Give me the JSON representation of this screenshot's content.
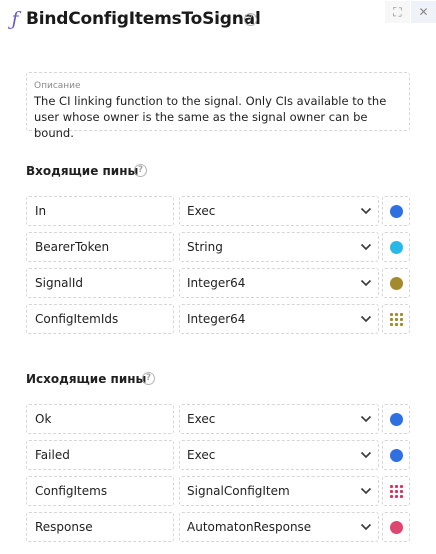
{
  "header": {
    "fn_icon": "ƒ",
    "title": "BindConfigItemsToSignal",
    "help": "?",
    "expand_icon": "⛶",
    "close_icon": "✕"
  },
  "description": {
    "label": "Описание",
    "text": "The CI linking function to the signal. Only CIs available to the user whose owner is the same as the signal owner can be bound."
  },
  "inputs": {
    "title": "Входящие пины",
    "help": "?",
    "pins": [
      {
        "name": "In",
        "type": "Exec",
        "icon": "dot",
        "color": "#2f6fe0"
      },
      {
        "name": "BearerToken",
        "type": "String",
        "icon": "dot",
        "color": "#29b9e6"
      },
      {
        "name": "SignalId",
        "type": "Integer64",
        "icon": "dot",
        "color": "#a38a2a"
      },
      {
        "name": "ConfigItemIds",
        "type": "Integer64",
        "icon": "grid",
        "color": "#a38a2a"
      }
    ]
  },
  "outputs": {
    "title": "Исходящие пины",
    "help": "?",
    "pins": [
      {
        "name": "Ok",
        "type": "Exec",
        "icon": "dot",
        "color": "#2f6fe0"
      },
      {
        "name": "Failed",
        "type": "Exec",
        "icon": "dot",
        "color": "#2f6fe0"
      },
      {
        "name": "ConfigItems",
        "type": "SignalConfigItem",
        "icon": "grid",
        "color": "#d8335f"
      },
      {
        "name": "Response",
        "type": "AutomatonResponse",
        "icon": "dot",
        "color": "#dd4670"
      }
    ]
  }
}
